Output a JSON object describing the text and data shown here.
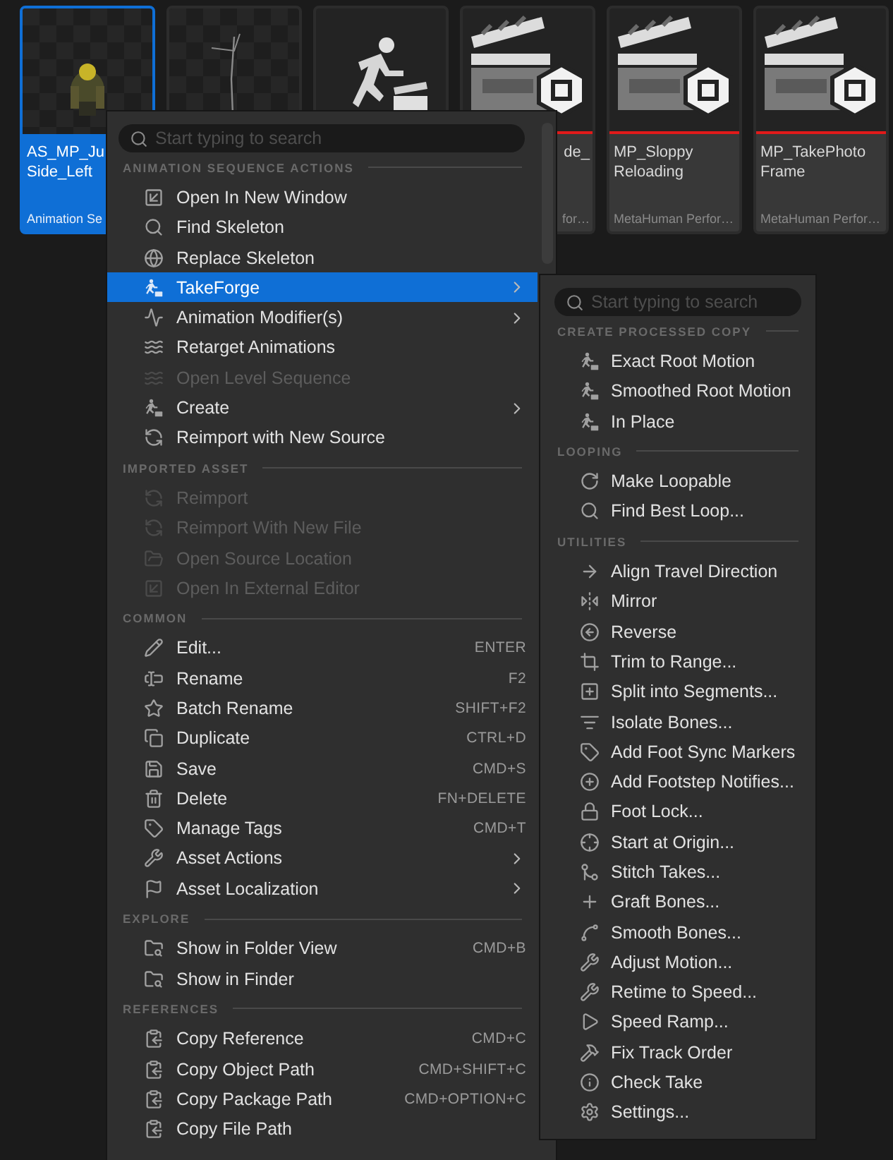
{
  "assets": [
    {
      "kind": "character",
      "selected": true,
      "name_lines": [
        "AS_MP_Ju",
        "Side_Left"
      ],
      "type": "Animation Se"
    },
    {
      "kind": "skeleton",
      "selected": false
    },
    {
      "kind": "runner",
      "selected": false
    },
    {
      "kind": "performance",
      "selected": false,
      "name_lines": [
        "de_"
      ],
      "type": "for…"
    },
    {
      "kind": "performance",
      "selected": false,
      "name_lines": [
        "MP_Sloppy",
        "Reloading"
      ],
      "type": "MetaHuman Perfor…"
    },
    {
      "kind": "performance",
      "selected": false,
      "name_lines": [
        "MP_TakePhoto",
        "Frame"
      ],
      "type": "MetaHuman Perfor…"
    }
  ],
  "context_menu": {
    "search": {
      "placeholder": "Start typing to search"
    },
    "sections": [
      {
        "title": "ANIMATION SEQUENCE ACTIONS",
        "items": [
          {
            "label": "Open In New Window",
            "disabled": false,
            "selected": false,
            "submenu": false
          },
          {
            "label": "Find Skeleton",
            "disabled": false,
            "selected": false,
            "submenu": false
          },
          {
            "label": "Replace Skeleton",
            "disabled": false,
            "selected": false,
            "submenu": false
          },
          {
            "label": "TakeForge",
            "disabled": false,
            "selected": true,
            "submenu": true
          },
          {
            "label": "Animation Modifier(s)",
            "disabled": false,
            "selected": false,
            "submenu": true
          },
          {
            "label": "Retarget Animations",
            "disabled": false,
            "selected": false,
            "submenu": false
          },
          {
            "label": "Open Level Sequence",
            "disabled": true,
            "selected": false,
            "submenu": false
          },
          {
            "label": "Create",
            "disabled": false,
            "selected": false,
            "submenu": true
          },
          {
            "label": "Reimport with New Source",
            "disabled": false,
            "selected": false,
            "submenu": false
          }
        ]
      },
      {
        "title": "IMPORTED ASSET",
        "items": [
          {
            "label": "Reimport",
            "disabled": true,
            "selected": false,
            "submenu": false
          },
          {
            "label": "Reimport With New File",
            "disabled": true,
            "selected": false,
            "submenu": false
          },
          {
            "label": "Open Source Location",
            "disabled": true,
            "selected": false,
            "submenu": false
          },
          {
            "label": "Open In External Editor",
            "disabled": true,
            "selected": false,
            "submenu": false
          }
        ]
      },
      {
        "title": "COMMON",
        "items": [
          {
            "label": "Edit...",
            "shortcut": "ENTER",
            "disabled": false,
            "selected": false,
            "submenu": false
          },
          {
            "label": "Rename",
            "shortcut": "F2",
            "disabled": false,
            "selected": false,
            "submenu": false
          },
          {
            "label": "Batch Rename",
            "shortcut": "SHIFT+F2",
            "disabled": false,
            "selected": false,
            "submenu": false
          },
          {
            "label": "Duplicate",
            "shortcut": "CTRL+D",
            "disabled": false,
            "selected": false,
            "submenu": false
          },
          {
            "label": "Save",
            "shortcut": "CMD+S",
            "disabled": false,
            "selected": false,
            "submenu": false
          },
          {
            "label": "Delete",
            "shortcut": "FN+DELETE",
            "disabled": false,
            "selected": false,
            "submenu": false
          },
          {
            "label": "Manage Tags",
            "shortcut": "CMD+T",
            "disabled": false,
            "selected": false,
            "submenu": false
          },
          {
            "label": "Asset Actions",
            "disabled": false,
            "selected": false,
            "submenu": true
          },
          {
            "label": "Asset Localization",
            "disabled": false,
            "selected": false,
            "submenu": true
          }
        ]
      },
      {
        "title": "EXPLORE",
        "items": [
          {
            "label": "Show in Folder View",
            "shortcut": "CMD+B",
            "disabled": false,
            "selected": false,
            "submenu": false
          },
          {
            "label": "Show in Finder",
            "disabled": false,
            "selected": false,
            "submenu": false
          }
        ]
      },
      {
        "title": "REFERENCES",
        "items": [
          {
            "label": "Copy Reference",
            "shortcut": "CMD+C",
            "disabled": false,
            "selected": false,
            "submenu": false
          },
          {
            "label": "Copy Object Path",
            "shortcut": "CMD+SHIFT+C",
            "disabled": false,
            "selected": false,
            "submenu": false
          },
          {
            "label": "Copy Package Path",
            "shortcut": "CMD+OPTION+C",
            "disabled": false,
            "selected": false,
            "submenu": false
          },
          {
            "label": "Copy File Path",
            "disabled": false,
            "selected": false,
            "submenu": false
          }
        ]
      }
    ]
  },
  "submenu": {
    "search": {
      "placeholder": "Start typing to search"
    },
    "sections": [
      {
        "title": "CREATE PROCESSED COPY",
        "items": [
          {
            "label": "Exact Root Motion"
          },
          {
            "label": "Smoothed Root Motion"
          },
          {
            "label": "In Place"
          }
        ]
      },
      {
        "title": "LOOPING",
        "items": [
          {
            "label": "Make Loopable"
          },
          {
            "label": "Find Best Loop..."
          }
        ]
      },
      {
        "title": "UTILITIES",
        "items": [
          {
            "label": "Align Travel Direction"
          },
          {
            "label": "Mirror"
          },
          {
            "label": "Reverse"
          },
          {
            "label": "Trim to Range..."
          },
          {
            "label": "Split into Segments..."
          },
          {
            "label": "Isolate Bones..."
          },
          {
            "label": "Add Foot Sync Markers"
          },
          {
            "label": "Add Footstep Notifies..."
          },
          {
            "label": "Foot Lock..."
          },
          {
            "label": "Start at Origin..."
          },
          {
            "label": "Stitch Takes..."
          },
          {
            "label": "Graft Bones..."
          },
          {
            "label": "Smooth Bones..."
          },
          {
            "label": "Adjust Motion..."
          },
          {
            "label": "Retime to Speed..."
          },
          {
            "label": "Speed Ramp..."
          },
          {
            "label": "Fix Track Order"
          },
          {
            "label": "Check Take"
          },
          {
            "label": "Settings..."
          }
        ]
      }
    ]
  }
}
